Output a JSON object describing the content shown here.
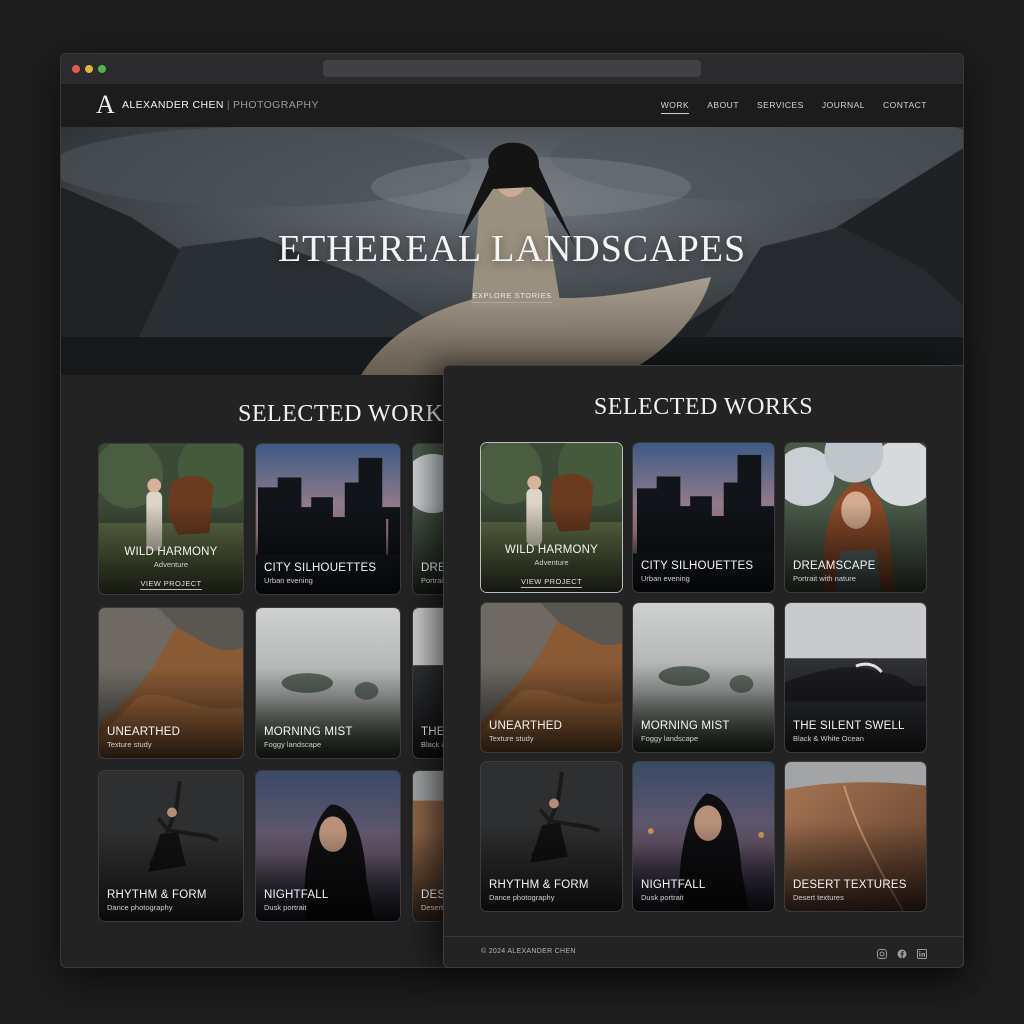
{
  "brand": {
    "logo_letter": "A",
    "name": "ALEXANDER CHEN",
    "separator": "|",
    "tagline": "PHOTOGRAPHY"
  },
  "nav": [
    {
      "label": "WORK",
      "active": true
    },
    {
      "label": "ABOUT"
    },
    {
      "label": "SERVICES"
    },
    {
      "label": "JOURNAL"
    },
    {
      "label": "CONTACT"
    }
  ],
  "hero": {
    "title": "ETHEREAL LANDSCAPES",
    "link": "EXPLORE STORIES"
  },
  "section_title": "SELECTED WORKS",
  "view_project": "VIEW PROJECT",
  "projects": [
    {
      "title": "WILD HARMONY",
      "subtitle": "Adventure",
      "icon": "woman-with-horse"
    },
    {
      "title": "CITY SILHOUETTES",
      "subtitle": "Urban evening",
      "icon": "city-skyline"
    },
    {
      "title": "DREAMSCAPE",
      "subtitle": "Portrait with nature",
      "icon": "portrait-clouds"
    },
    {
      "title": "UNEARTHED",
      "subtitle": "Texture study",
      "icon": "rock-texture"
    },
    {
      "title": "MORNING MIST",
      "subtitle": "Foggy landscape",
      "icon": "misty-field"
    },
    {
      "title": "THE SILENT SWELL",
      "subtitle": "Black & White Ocean",
      "icon": "ocean-wave"
    },
    {
      "title": "RHYTHM & FORM",
      "subtitle": "Dance photography",
      "icon": "dancer"
    },
    {
      "title": "NIGHTFALL",
      "subtitle": "Dusk portrait",
      "icon": "dusk-portrait"
    },
    {
      "title": "DESERT TEXTURES",
      "subtitle": "Desert textures",
      "icon": "sand-dunes"
    }
  ],
  "back_partial": [
    {
      "title": "DRE",
      "subtitle": "Portrai"
    },
    {
      "title": "THE",
      "subtitle": "Black &"
    },
    {
      "title": "DESE",
      "subtitle": "Desert"
    }
  ],
  "footer": {
    "copyright": "© 2024 ALEXANDER CHEN",
    "social_icons": [
      "instagram-icon",
      "facebook-icon",
      "linkedin-icon"
    ]
  },
  "colors": {
    "background": "#1d1d1e",
    "panel": "#232324",
    "text": "#f0f0f0",
    "muted": "#b5b5b5"
  }
}
